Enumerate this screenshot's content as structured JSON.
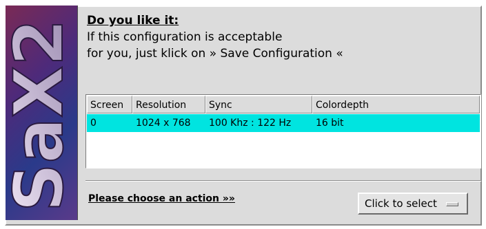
{
  "logo": {
    "text": "SaX2",
    "icon": "sax2-logo"
  },
  "header": {
    "title": "Do you like it:",
    "line1": "If this configuration is acceptable",
    "line2": "for you, just klick on » Save Configuration «"
  },
  "table": {
    "columns": [
      "Screen",
      "Resolution",
      "Sync",
      "Colordepth"
    ],
    "rows": [
      [
        "0",
        "1024 x 768",
        "100 Khz : 122 Hz",
        "16 bit"
      ]
    ],
    "selected_row_color": "#00e4e0"
  },
  "footer": {
    "action_label": "Please choose an action »»",
    "select_value": "Click to select"
  }
}
